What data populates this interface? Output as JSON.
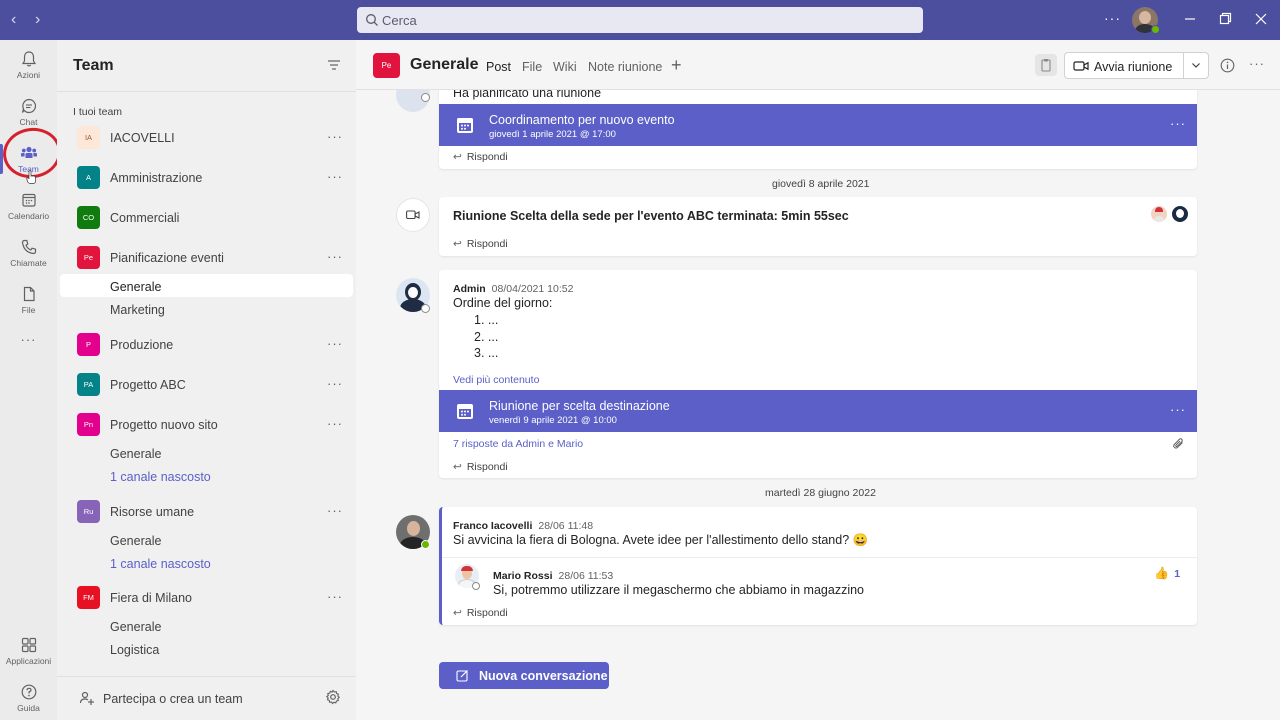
{
  "titlebar": {
    "search_placeholder": "Cerca",
    "back": "‹",
    "forward": "›",
    "more": "···"
  },
  "rail": {
    "items": [
      {
        "label": "Azioni"
      },
      {
        "label": "Chat"
      },
      {
        "label": "Team"
      },
      {
        "label": "Calendario"
      },
      {
        "label": "Chiamate"
      },
      {
        "label": "File"
      },
      {
        "label": "···"
      },
      {
        "label": "Applicazioni"
      },
      {
        "label": "Guida"
      }
    ]
  },
  "panel": {
    "title": "Team",
    "section": "I tuoi team",
    "teams": [
      {
        "initials": "IA",
        "name": "IACOVELLI",
        "color": "#fde7d9",
        "text_color": "#a15d2b"
      },
      {
        "initials": "A",
        "name": "Amministrazione",
        "color": "#038387"
      },
      {
        "initials": "CO",
        "name": "Commerciali",
        "color": "#107c10"
      },
      {
        "initials": "Pe",
        "name": "Pianificazione eventi",
        "color": "#e0143c"
      },
      {
        "initials": "P",
        "name": "Produzione",
        "color": "#e3008c"
      },
      {
        "initials": "PA",
        "name": "Progetto ABC",
        "color": "#038387"
      },
      {
        "initials": "Pn",
        "name": "Progetto nuovo sito",
        "color": "#e3008c"
      },
      {
        "initials": "Ru",
        "name": "Risorse umane",
        "color": "#8764b8"
      },
      {
        "initials": "FM",
        "name": "Fiera di Milano",
        "color": "#e81123"
      }
    ],
    "channels": {
      "pianificazione": [
        "Generale",
        "Marketing"
      ],
      "nuovo_sito": [
        "Generale",
        "1 canale nascosto"
      ],
      "risorse": [
        "Generale",
        "1 canale nascosto"
      ],
      "fiera": [
        "Generale",
        "Logistica"
      ]
    },
    "more": "···",
    "footer": "Partecipa o crea un team"
  },
  "channel": {
    "avatar": "Pe",
    "name": "Generale",
    "tabs": [
      "Post",
      "File",
      "Wiki",
      "Note riunione"
    ],
    "add_tab": "+",
    "meet_label": "Avvia riunione",
    "more": "···"
  },
  "feed": {
    "msg1": {
      "text": "Ha pianificato una riunione",
      "meeting_title": "Coordinamento per nuovo evento",
      "meeting_date": "giovedì 1 aprile 2021 @ 17:00",
      "reply": "Rispondi"
    },
    "date1": "giovedì 8 aprile 2021",
    "msg2": {
      "text": "Riunione Scelta della sede per l'evento ABC terminata: 5min 55sec",
      "reply": "Rispondi"
    },
    "msg3": {
      "sender": "Admin",
      "time": "08/04/2021 10:52",
      "text": "Ordine del giorno:",
      "items": [
        "1. ...",
        "2. ...",
        "3. ..."
      ],
      "see_more": "Vedi più contenuto",
      "meeting_title": "Riunione per scelta destinazione",
      "meeting_date": "venerdì 9 aprile 2021 @ 10:00",
      "replies": "7 risposte da Admin e Mario",
      "reply": "Rispondi"
    },
    "date2": "martedì 28 giugno 2022",
    "msg4": {
      "sender": "Franco Iacovelli",
      "time": "28/06 11:48",
      "text": "Si avvicina la fiera di Bologna. Avete idee per l'allestimento dello stand? 😀",
      "reply_sender": "Mario Rossi",
      "reply_time": "28/06 11:53",
      "reply_text": "Si, potremmo utilizzare il megaschermo che abbiamo in magazzino",
      "reaction_emoji": "👍",
      "reaction_count": "1",
      "reply": "Rispondi"
    },
    "new_conversation": "Nuova conversazione"
  },
  "colors": {
    "brand": "#5b5fc7",
    "titlebar": "#4b4f9e",
    "annotation": "#d6202a"
  }
}
